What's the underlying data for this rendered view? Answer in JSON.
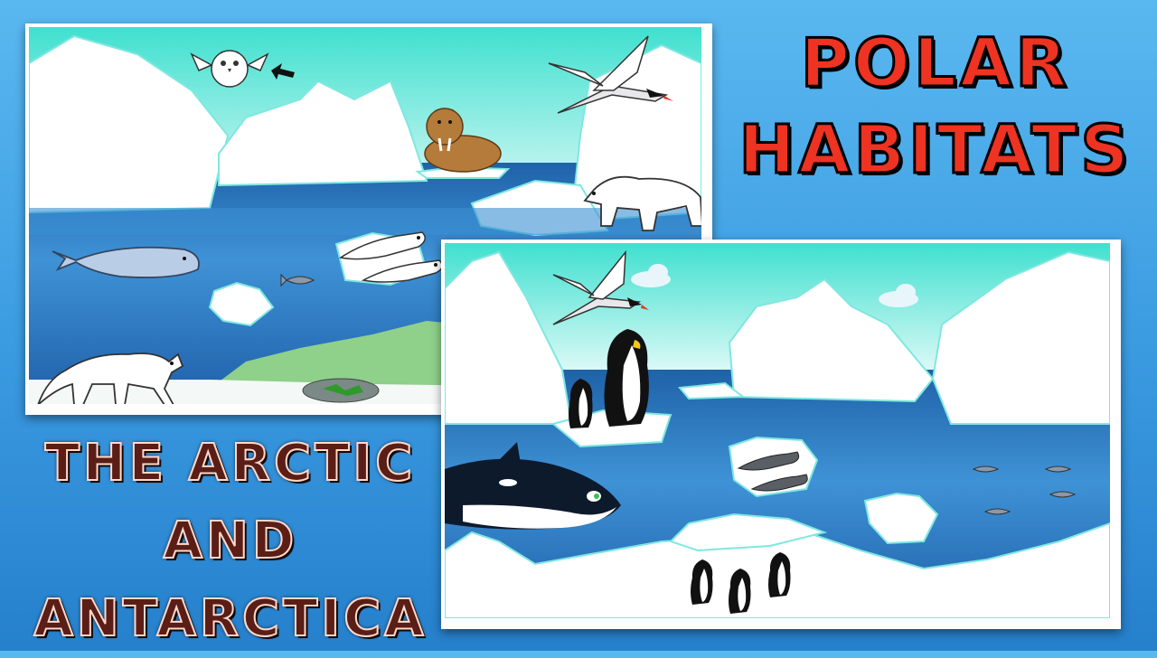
{
  "title": {
    "line1": "POLAR",
    "line2": "HABITATS"
  },
  "subtitle": {
    "line1": "THE ARCTIC",
    "line2": "AND",
    "line3": "ANTARCTICA"
  },
  "colors": {
    "background": "#3a9ae0",
    "title_fill": "#ee3322",
    "subtitle_fill": "#5a1e16",
    "sky_top": "#4fe0d0",
    "sky_bottom": "#d8f6f4",
    "ocean": "#2f7fc7",
    "ice": "#ffffff"
  },
  "arctic_scene": {
    "animals": [
      "snowy-owl",
      "arctic-tern",
      "walrus",
      "polar-bear",
      "beluga-whale",
      "harp-seal",
      "harp-seal",
      "arctic-fox",
      "fish"
    ],
    "pointer": "arrow-left-icon"
  },
  "antarctic_scene": {
    "animals": [
      "arctic-tern",
      "emperor-penguin",
      "emperor-penguin",
      "orca",
      "weddell-seal",
      "weddell-seal",
      "emperor-penguin",
      "emperor-penguin",
      "emperor-penguin",
      "fish",
      "fish",
      "fish",
      "fish",
      "fish"
    ]
  }
}
